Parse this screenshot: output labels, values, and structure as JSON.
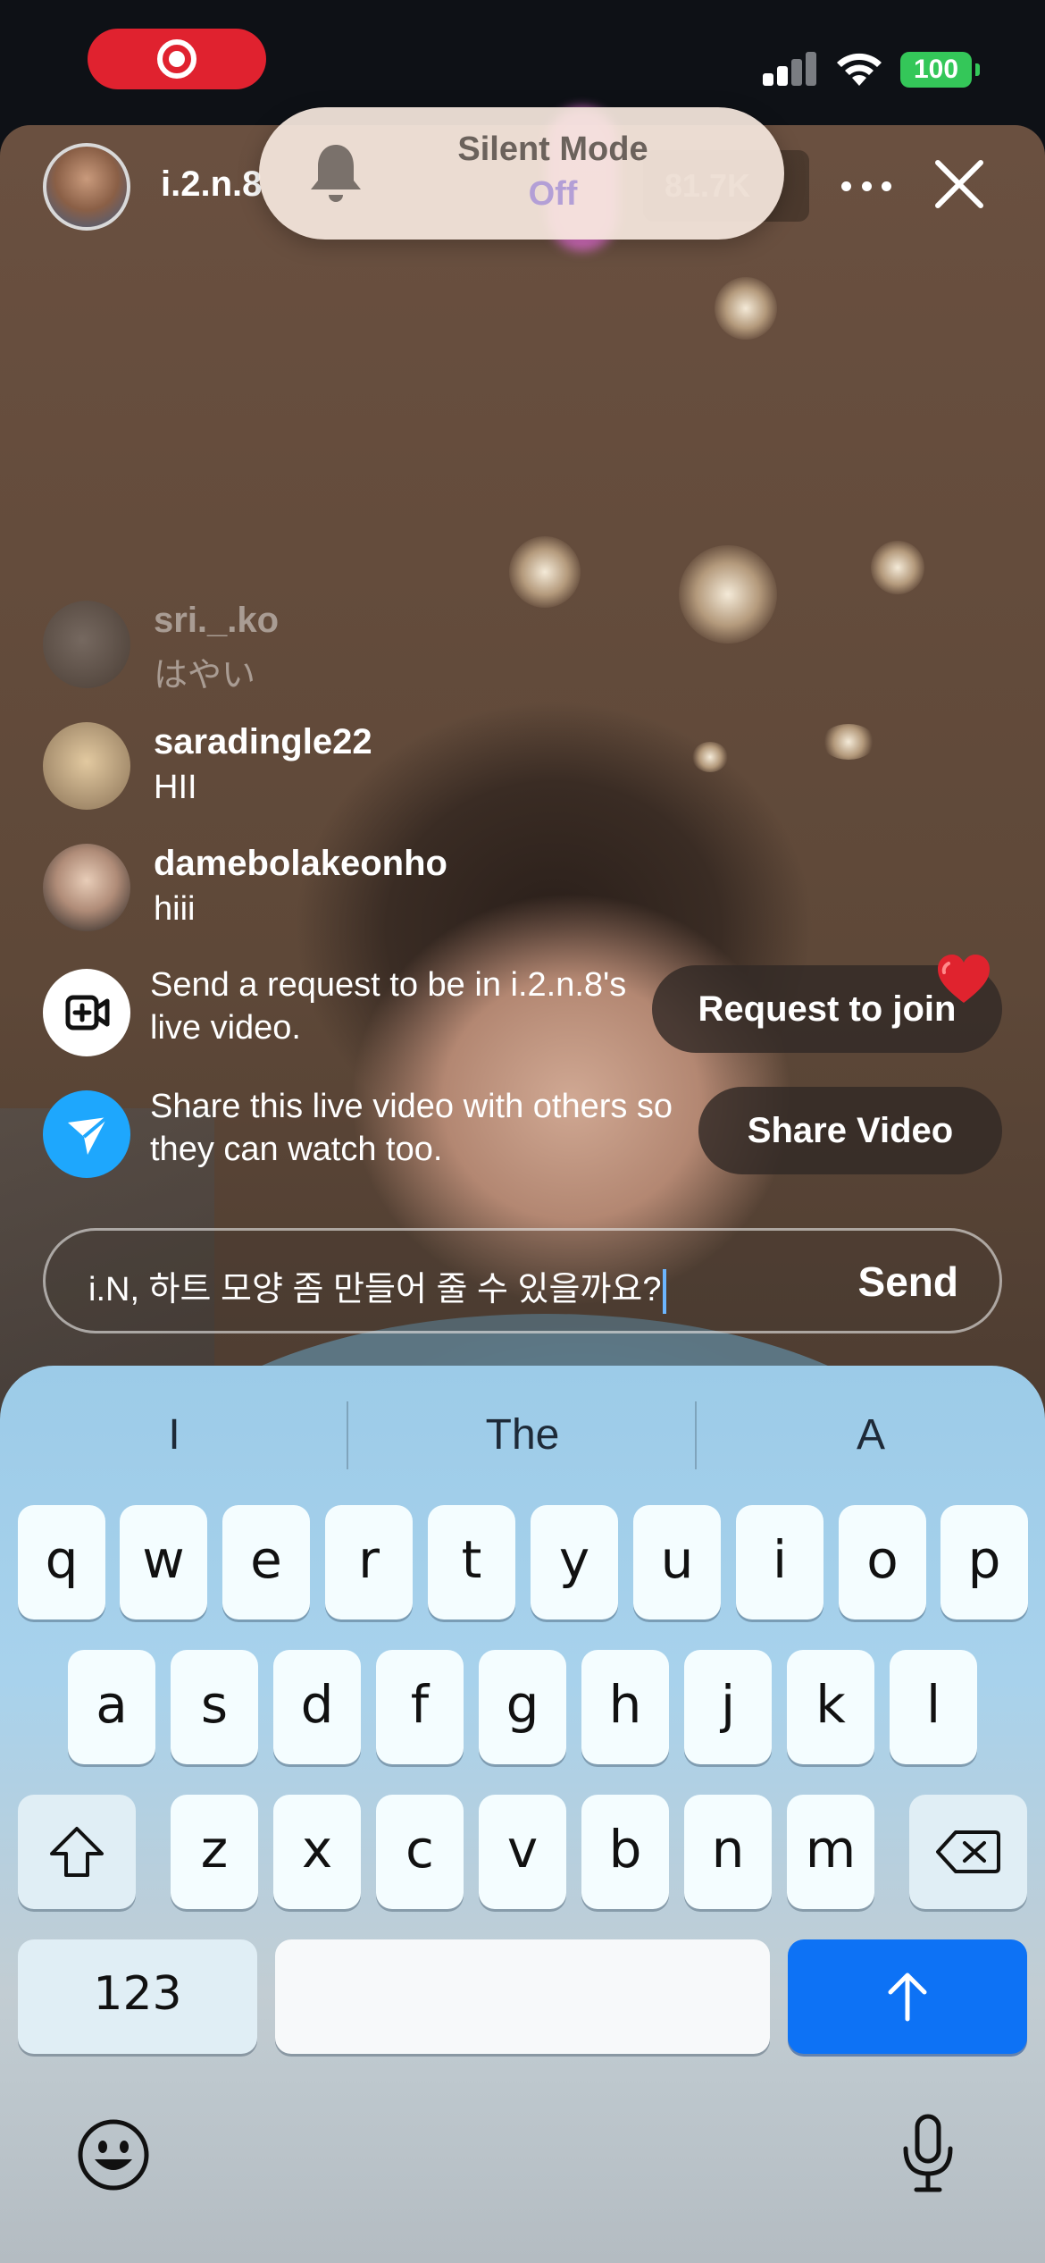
{
  "status_bar": {
    "battery": "100"
  },
  "live": {
    "host_name": "i.2.n.8",
    "viewer_count": "81.7K"
  },
  "silent_mode": {
    "title": "Silent Mode",
    "state": "Off"
  },
  "comments": [
    {
      "user": "sri._.ko",
      "message": "はやい"
    },
    {
      "user": "saradingle22",
      "message": "HII"
    },
    {
      "user": "damebolakeonho",
      "message": "hiii"
    }
  ],
  "prompts": {
    "request": {
      "text": "Send a request to be in i.2.n.8's live video.",
      "button": "Request to join"
    },
    "share": {
      "text": "Share this live video with others so they can watch too.",
      "button": "Share Video"
    }
  },
  "comment_input": {
    "value": "i.N, 하트 모양 좀 만들어 줄 수 있을까요?",
    "send_label": "Send"
  },
  "keyboard": {
    "suggestions": [
      "I",
      "The",
      "A"
    ],
    "row1": [
      "q",
      "w",
      "e",
      "r",
      "t",
      "y",
      "u",
      "i",
      "o",
      "p"
    ],
    "row2": [
      "a",
      "s",
      "d",
      "f",
      "g",
      "h",
      "j",
      "k",
      "l"
    ],
    "row3": [
      "z",
      "x",
      "c",
      "v",
      "b",
      "n",
      "m"
    ],
    "numbers_label": "123"
  },
  "colors": {
    "accent_blue": "#0d72f5",
    "record_red": "#e0222f",
    "battery_green": "#34c759",
    "share_blue": "#1ea7fd"
  }
}
